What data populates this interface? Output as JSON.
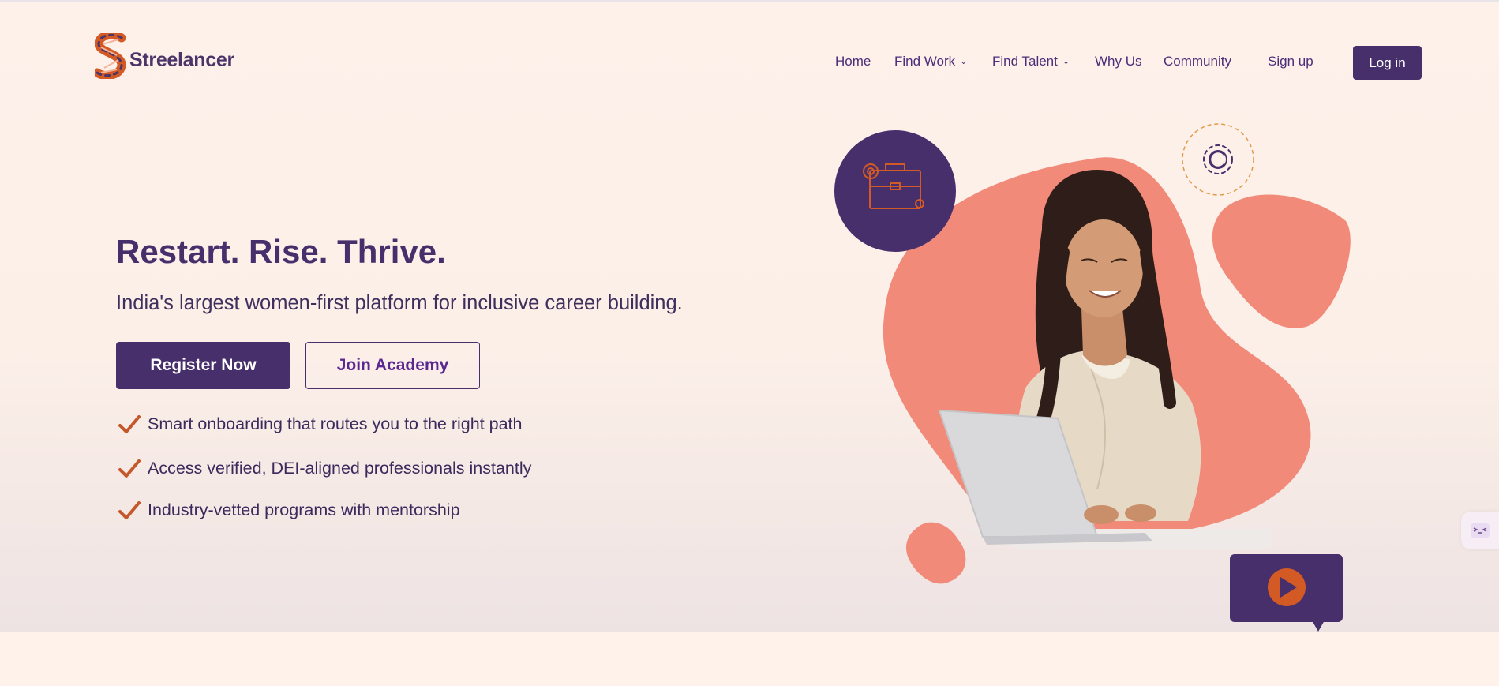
{
  "brand": {
    "name": "Streelancer"
  },
  "nav": {
    "items": [
      {
        "label": "Home"
      },
      {
        "label": "Find Work"
      },
      {
        "label": "Find Talent"
      },
      {
        "label": "Why Us"
      },
      {
        "label": "Community"
      }
    ],
    "signup_label": "Sign up",
    "login_label": "Log in"
  },
  "hero": {
    "title": "Restart. Rise. Thrive.",
    "subtitle": "India's largest women-first platform for inclusive career building.",
    "primary_cta": "Register Now",
    "secondary_cta": "Join Academy",
    "features": [
      {
        "text": "Smart onboarding that routes you to the right path"
      },
      {
        "text": "Access verified, DEI-aligned professionals instantly"
      },
      {
        "text": "Industry-vetted programs with mentorship"
      }
    ]
  },
  "colors": {
    "brand_purple": "#472f6b",
    "accent_coral": "#f28a7a",
    "accent_orange": "#d45a25",
    "background": "#fdf1ea"
  },
  "icons": [
    "logo-s-icon",
    "chevron-down-icon",
    "check-icon",
    "briefcase-icon",
    "gear-icon",
    "play-icon",
    "chat-widget-icon"
  ]
}
